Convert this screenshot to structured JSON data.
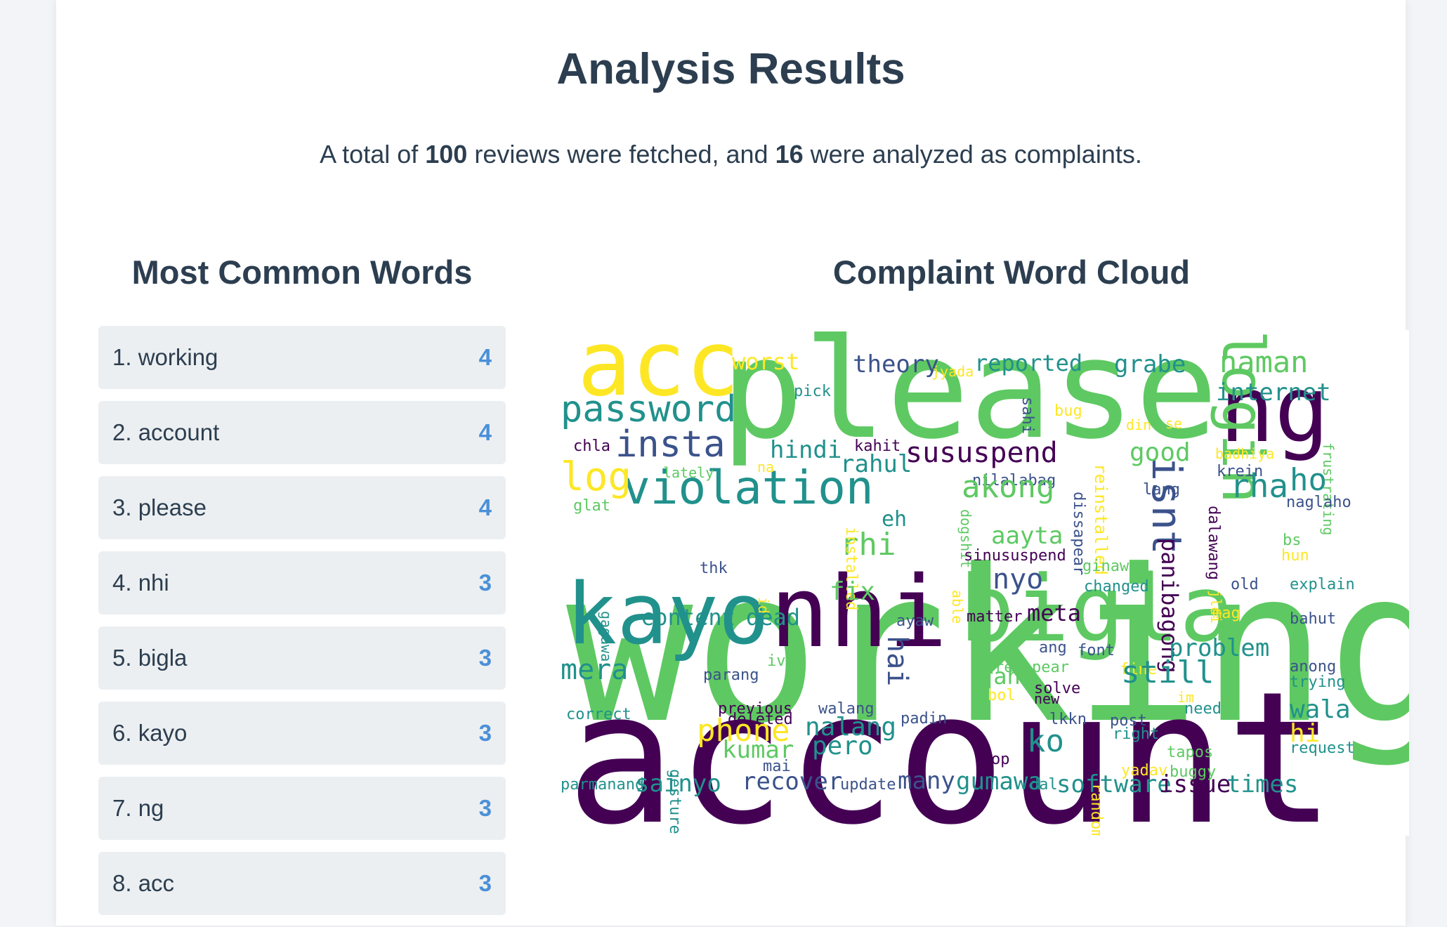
{
  "page": {
    "title": "Analysis Results",
    "summary": {
      "prefix": "A total of ",
      "total_reviews": "100",
      "middle": " reviews were fetched, and ",
      "complaints": "16",
      "suffix": " were analyzed as complaints."
    }
  },
  "common_words": {
    "title": "Most Common Words",
    "items": [
      {
        "label": "1. working",
        "count": "4"
      },
      {
        "label": "2. account",
        "count": "4"
      },
      {
        "label": "3. please",
        "count": "4"
      },
      {
        "label": "4. nhi",
        "count": "3"
      },
      {
        "label": "5. bigla",
        "count": "3"
      },
      {
        "label": "6. kayo",
        "count": "3"
      },
      {
        "label": "7. ng",
        "count": "3"
      },
      {
        "label": "8. acc",
        "count": "3"
      }
    ]
  },
  "word_cloud": {
    "title": "Complaint Word Cloud",
    "palette": [
      "#440154",
      "#3b528b",
      "#21918c",
      "#5ec962",
      "#fde725"
    ],
    "words": [
      "working",
      "account",
      "please",
      "acc",
      "nhi",
      "bigla",
      "kayo",
      "ng",
      "login",
      "violation",
      "password",
      "insta",
      "isnt",
      "sususpend",
      "naman",
      "internet",
      "theory",
      "reported",
      "grabe",
      "worst",
      "pick",
      "jyada",
      "reinstalled",
      "frustrating",
      "sahi",
      "bug",
      "din",
      "se",
      "hindi",
      "rahul",
      "chla",
      "kahit",
      "na",
      "good",
      "krein",
      "badhiya",
      "log",
      "lately",
      "nilalabag",
      "lang",
      "rha",
      "ho",
      "naglaho",
      "glat",
      "dogshit",
      "akong",
      "eh",
      "dissapear",
      "aayta",
      "rhi",
      "sinususpend",
      "ginawa",
      "panibagong",
      "dalawang",
      "bs",
      "hun",
      "thk",
      "installed",
      "nyo",
      "changed",
      "old",
      "explain",
      "fix",
      "hai",
      "id",
      "able",
      "jldi",
      "gagawa",
      "content",
      "dead",
      "ayaw",
      "matter",
      "meta",
      "mag",
      "bahut",
      "font",
      "ang",
      "problem",
      "ive",
      "mera",
      "parang",
      "reappear",
      "fine",
      "raha",
      "still",
      "anong",
      "trying",
      "bol",
      "solve",
      "new",
      "im",
      "need",
      "correct",
      "previous",
      "deleted",
      "walang",
      "padin",
      "lkkn",
      "post",
      "wala",
      "phone",
      "nalang",
      "right",
      "hi",
      "gestures",
      "pero",
      "ko",
      "randomly",
      "kumar",
      "mai",
      "op",
      "tapos",
      "request",
      "yadav",
      "buggy",
      "parmanand",
      "sainyo",
      "recover",
      "update",
      "many",
      "gumawa",
      "dal",
      "software",
      "issue",
      "times"
    ]
  }
}
